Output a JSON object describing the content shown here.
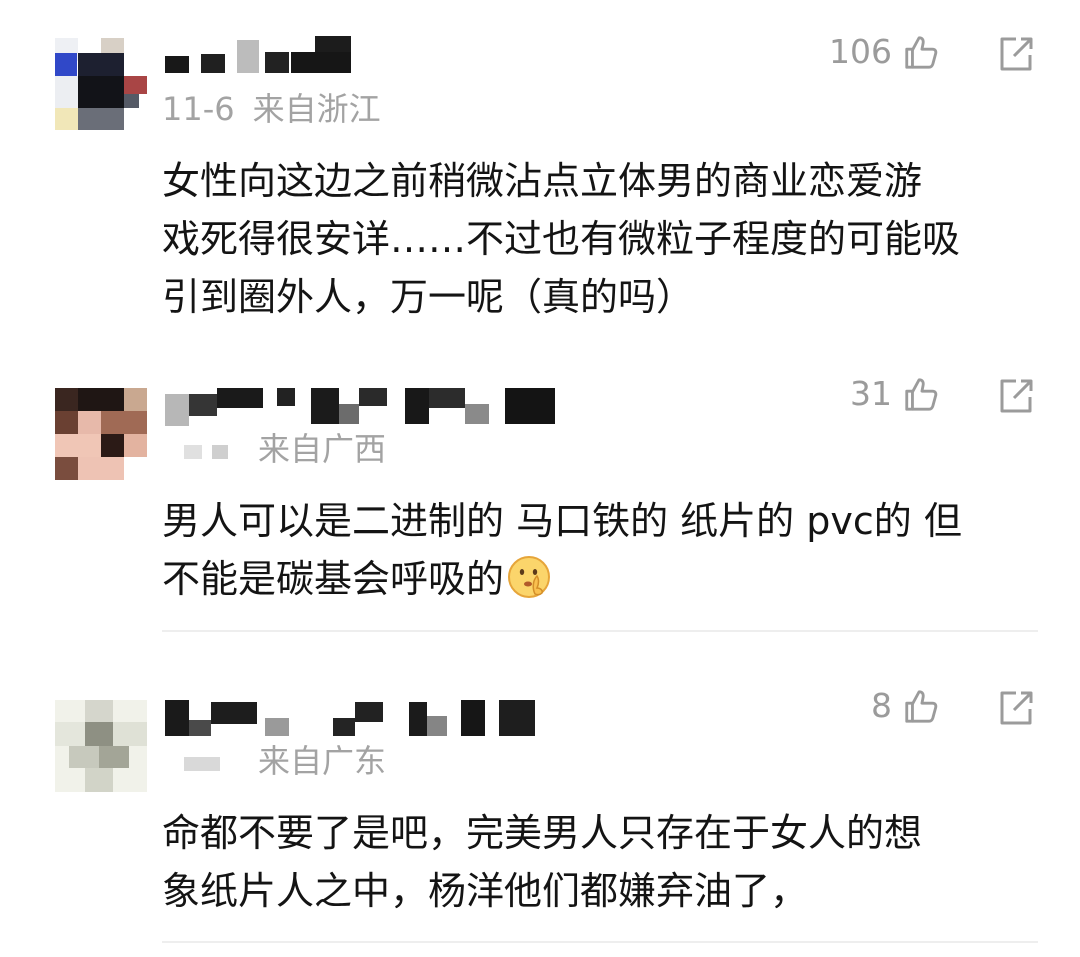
{
  "comments": [
    {
      "likes": "106",
      "meta_date": "11-6",
      "meta_source": "来自浙江",
      "lines": [
        "女性向这边之前稍微沾点立体男的商业恋爱游",
        "戏死得很安详……不过也有微粒子程度的可能吸",
        "引到圈外人，万一呢（真的吗）"
      ]
    },
    {
      "likes": "31",
      "meta_source": "来自广西",
      "lines": [
        "男人可以是二进制的 马口铁的 纸片的 pvc的 但",
        "不能是碳基会呼吸的"
      ],
      "emoji": "shushing-face-emoji"
    },
    {
      "likes": "8",
      "meta_source": "来自广东",
      "lines": [
        "命都不要了是吧，完美男人只存在于女人的想",
        "象纸片人之中，杨洋他们都嫌弃油了，"
      ]
    }
  ],
  "icons": {
    "like": "thumbs-up-icon",
    "share": "share-icon"
  },
  "colors": {
    "text": "#141414",
    "meta": "#a3a3a3",
    "icon": "#9b9b9b",
    "divider": "#eeeeee"
  }
}
